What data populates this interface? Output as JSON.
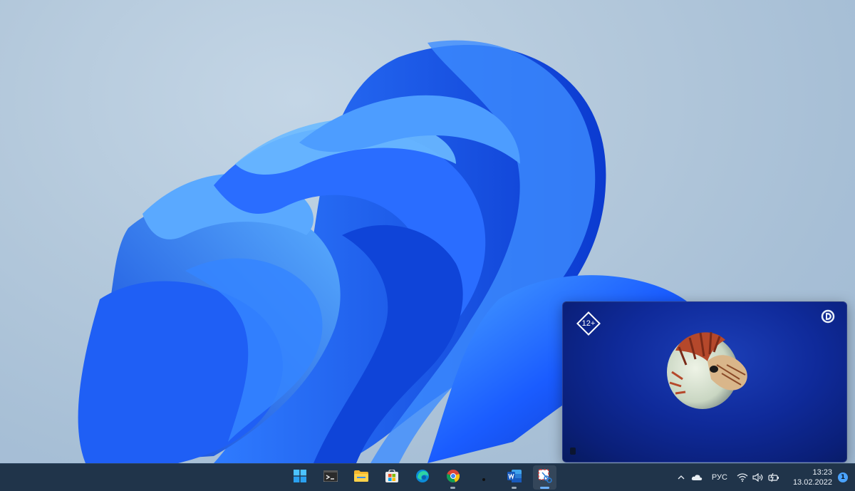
{
  "wallpaper": {
    "name": "Windows 11 Bloom",
    "accent": "#1a5cff"
  },
  "pip": {
    "age_rating": "12+",
    "channel_logo_icon": "discovery-logo-icon",
    "content_icon": "nautilus-shell-image"
  },
  "taskbar": {
    "apps": [
      {
        "name": "start-button",
        "icon": "windows-logo-icon",
        "active": false,
        "running": false
      },
      {
        "name": "terminal-button",
        "icon": "terminal-icon",
        "active": false,
        "running": false
      },
      {
        "name": "file-explorer-button",
        "icon": "folder-icon",
        "active": false,
        "running": false
      },
      {
        "name": "store-button",
        "icon": "store-icon",
        "active": false,
        "running": false
      },
      {
        "name": "edge-button",
        "icon": "edge-icon",
        "active": false,
        "running": false
      },
      {
        "name": "chrome-button",
        "icon": "chrome-icon",
        "active": false,
        "running": true
      },
      {
        "name": "unknown-app-button",
        "icon": "dot-icon",
        "active": false,
        "running": false
      },
      {
        "name": "word-button",
        "icon": "word-icon",
        "active": false,
        "running": true
      },
      {
        "name": "snipping-tool-button",
        "icon": "snipping-tool-icon",
        "active": true,
        "running": true
      }
    ],
    "tray": {
      "language": "РУС",
      "time": "13:23",
      "date": "13.02.2022",
      "notification_count": "1"
    }
  }
}
